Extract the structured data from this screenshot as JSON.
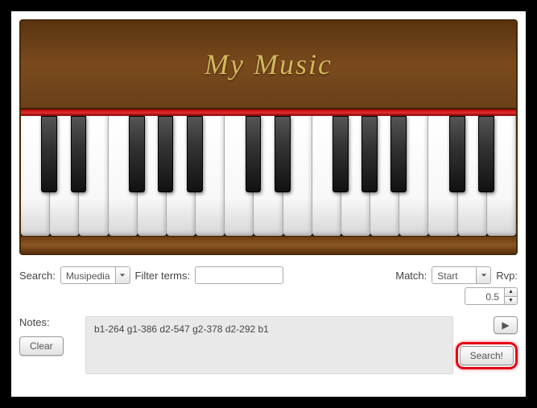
{
  "piano": {
    "title": "My  Music"
  },
  "labels": {
    "search": "Search:",
    "filter": "Filter terms:",
    "match": "Match:",
    "rvp": "Rvp:",
    "notes": "Notes:"
  },
  "search": {
    "source_value": "Musipedia",
    "filter_value": "",
    "match_value": "Start",
    "rvp_value": "0.5"
  },
  "notes": {
    "value": "b1-264 g1-386 d2-547 g2-378 d2-292 b1"
  },
  "buttons": {
    "clear": "Clear",
    "play": "▶",
    "search": "Search!"
  }
}
